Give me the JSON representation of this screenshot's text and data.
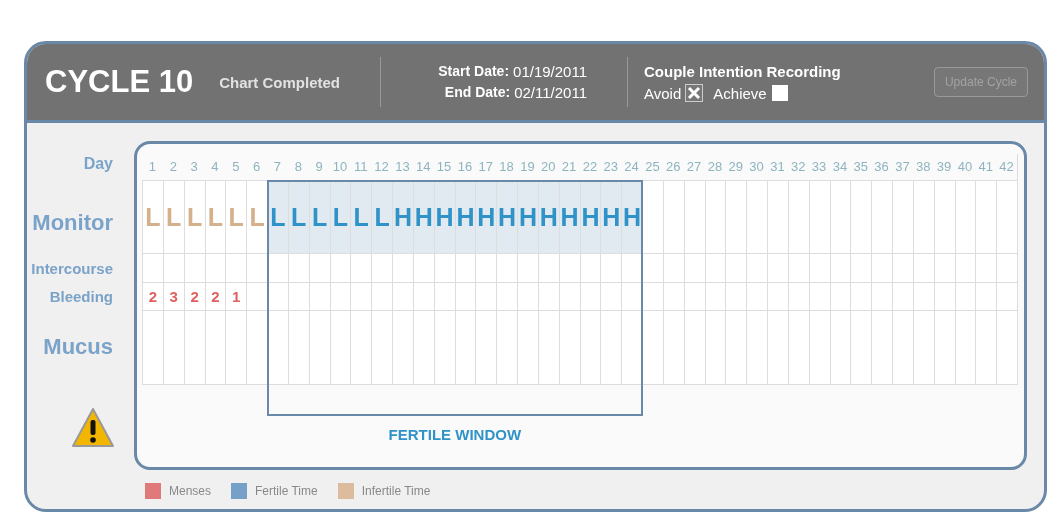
{
  "header": {
    "title": "CYCLE 10",
    "status": "Chart Completed",
    "start_label": "Start Date:",
    "start_date": "01/19/2011",
    "end_label": "End Date:",
    "end_date": "02/11/2011",
    "intention_title": "Couple Intention Recording",
    "intentions": [
      {
        "label": "Avoid",
        "checked": true
      },
      {
        "label": "Achieve",
        "checked": false
      }
    ],
    "update_button": {
      "label": "Update Cycle",
      "disabled": true
    }
  },
  "row_labels": {
    "day": "Day",
    "monitor": "Monitor",
    "intercourse": "Intercourse",
    "bleeding": "Bleeding",
    "mucus": "Mucus"
  },
  "days": [
    {
      "label": "1",
      "fertile": false
    },
    {
      "label": "2",
      "fertile": false
    },
    {
      "label": "3",
      "fertile": false
    },
    {
      "label": "4",
      "fertile": false
    },
    {
      "label": "5",
      "fertile": false
    },
    {
      "label": "6",
      "fertile": false
    },
    {
      "label": "7",
      "fertile": true
    },
    {
      "label": "8",
      "fertile": true
    },
    {
      "label": "9",
      "fertile": true
    },
    {
      "label": "10",
      "fertile": true
    },
    {
      "label": "11",
      "fertile": true
    },
    {
      "label": "12",
      "fertile": true
    },
    {
      "label": "13",
      "fertile": true
    },
    {
      "label": "14",
      "fertile": true
    },
    {
      "label": "15",
      "fertile": true
    },
    {
      "label": "16",
      "fertile": true
    },
    {
      "label": "17",
      "fertile": true
    },
    {
      "label": "18",
      "fertile": true
    },
    {
      "label": "19",
      "fertile": true
    },
    {
      "label": "20",
      "fertile": true
    },
    {
      "label": "21",
      "fertile": true
    },
    {
      "label": "22",
      "fertile": true
    },
    {
      "label": "23",
      "fertile": true
    },
    {
      "label": "24",
      "fertile": true
    },
    {
      "label": "25",
      "fertile": false
    },
    {
      "label": "26",
      "fertile": false
    },
    {
      "label": "27",
      "fertile": false
    },
    {
      "label": "28",
      "fertile": false
    },
    {
      "label": "29",
      "fertile": false
    },
    {
      "label": "30",
      "fertile": false
    },
    {
      "label": "31",
      "fertile": false
    },
    {
      "label": "32",
      "fertile": false
    },
    {
      "label": "33",
      "fertile": false
    },
    {
      "label": "34",
      "fertile": false
    },
    {
      "label": "35",
      "fertile": false
    },
    {
      "label": "36",
      "fertile": false
    },
    {
      "label": "37",
      "fertile": false
    },
    {
      "label": "38",
      "fertile": false
    },
    {
      "label": "39",
      "fertile": false
    },
    {
      "label": "40",
      "fertile": false
    },
    {
      "label": "41",
      "fertile": false
    },
    {
      "label": "42",
      "fertile": false
    }
  ],
  "monitor": [
    {
      "reading": "L",
      "kind": "infertile"
    },
    {
      "reading": "L",
      "kind": "infertile"
    },
    {
      "reading": "L",
      "kind": "infertile"
    },
    {
      "reading": "L",
      "kind": "infertile"
    },
    {
      "reading": "L",
      "kind": "infertile"
    },
    {
      "reading": "L",
      "kind": "infertile"
    },
    {
      "reading": "L",
      "kind": "fertile"
    },
    {
      "reading": "L",
      "kind": "fertile"
    },
    {
      "reading": "L",
      "kind": "fertile"
    },
    {
      "reading": "L",
      "kind": "fertile"
    },
    {
      "reading": "L",
      "kind": "fertile"
    },
    {
      "reading": "L",
      "kind": "fertile"
    },
    {
      "reading": "H",
      "kind": "fertile"
    },
    {
      "reading": "H",
      "kind": "fertile"
    },
    {
      "reading": "H",
      "kind": "fertile"
    },
    {
      "reading": "H",
      "kind": "fertile"
    },
    {
      "reading": "H",
      "kind": "fertile"
    },
    {
      "reading": "H",
      "kind": "fertile"
    },
    {
      "reading": "H",
      "kind": "fertile"
    },
    {
      "reading": "H",
      "kind": "fertile"
    },
    {
      "reading": "H",
      "kind": "fertile"
    },
    {
      "reading": "H",
      "kind": "fertile"
    },
    {
      "reading": "H",
      "kind": "fertile"
    },
    {
      "reading": "H",
      "kind": "fertile"
    }
  ],
  "bleeding": [
    "2",
    "3",
    "2",
    "2",
    "1"
  ],
  "fertile_window_label": "FERTILE WINDOW",
  "legend": [
    {
      "label": "Menses",
      "color": "#e07a7a"
    },
    {
      "label": "Fertile Time",
      "color": "#76a0c8"
    },
    {
      "label": "Infertile Time",
      "color": "#dcbc9c"
    }
  ]
}
